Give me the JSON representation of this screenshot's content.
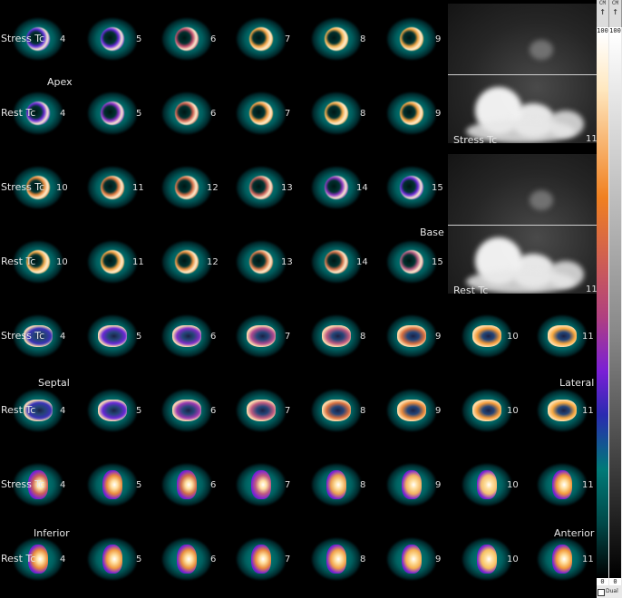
{
  "labels": {
    "stress": "Stress Tc",
    "rest": "Rest Tc",
    "apex": "Apex",
    "base": "Base",
    "septal": "Septal",
    "lateral": "Lateral",
    "inferior": "Inferior",
    "anterior": "Anterior"
  },
  "rows": [
    {
      "name": "sa-stress-1",
      "label": "Stress Tc",
      "numbers": [
        "4",
        "5",
        "6",
        "7",
        "8",
        "9"
      ]
    },
    {
      "name": "sa-rest-1",
      "label": "Rest Tc",
      "numbers": [
        "4",
        "5",
        "6",
        "7",
        "8",
        "9"
      ]
    },
    {
      "name": "sa-stress-2",
      "label": "Stress Tc",
      "numbers": [
        "10",
        "11",
        "12",
        "13",
        "14",
        "15"
      ]
    },
    {
      "name": "sa-rest-2",
      "label": "Rest Tc",
      "numbers": [
        "10",
        "11",
        "12",
        "13",
        "14",
        "15"
      ]
    },
    {
      "name": "hla-stress",
      "label": "Stress Tc",
      "numbers": [
        "4",
        "5",
        "6",
        "7",
        "8",
        "9",
        "10",
        "11"
      ]
    },
    {
      "name": "hla-rest",
      "label": "Rest Tc",
      "numbers": [
        "4",
        "5",
        "6",
        "7",
        "8",
        "9",
        "10",
        "11"
      ]
    },
    {
      "name": "vla-stress",
      "label": "Stress Tc",
      "numbers": [
        "4",
        "5",
        "6",
        "7",
        "8",
        "9",
        "10",
        "11"
      ]
    },
    {
      "name": "vla-rest",
      "label": "Rest Tc",
      "numbers": [
        "4",
        "5",
        "6",
        "7",
        "8",
        "9",
        "10",
        "11"
      ]
    }
  ],
  "planar": [
    {
      "label": "Stress Tc",
      "number": "11"
    },
    {
      "label": "Rest Tc",
      "number": "11"
    }
  ],
  "colorbar": {
    "heads": [
      "CM",
      "CM"
    ],
    "max": "100",
    "min": "0",
    "dual_label": "Dual"
  },
  "colors": {
    "teal": "#008a88",
    "purple": "#7a1fd6",
    "orange": "#f07a1a",
    "white": "#ffffff"
  }
}
